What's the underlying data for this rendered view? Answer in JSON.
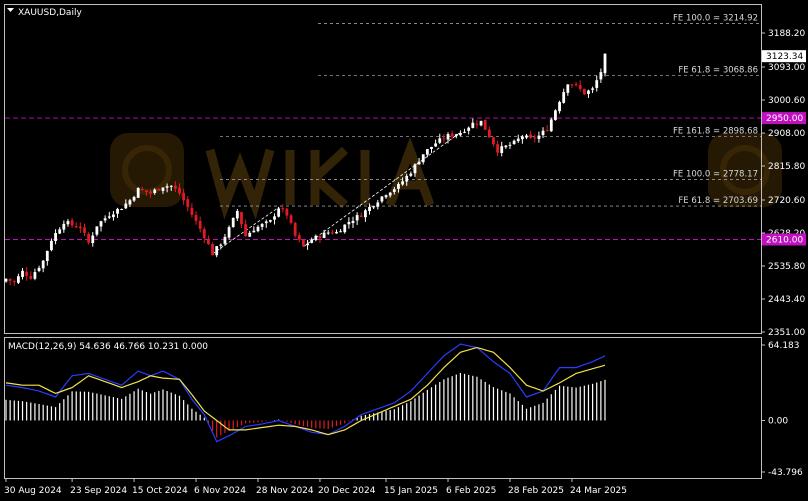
{
  "window": {
    "symbol_label": "XAUUSD,Daily"
  },
  "colors": {
    "background": "#000000",
    "bull": "#ffffff",
    "bear": "#e01b24",
    "grid": "#9a9a9a",
    "level": "#c010c0",
    "macd": "#2a3cff",
    "signal": "#f2e24a",
    "watermark": "#3a2808"
  },
  "chart_data": [
    {
      "type": "candlestick",
      "title": "XAUUSD,Daily",
      "ylim": [
        2351.0,
        3250.0
      ],
      "y_ticks": [
        "3188.20",
        "3093.00",
        "3000.60",
        "2908.00",
        "2815.80",
        "2720.60",
        "2628.20",
        "2535.80",
        "2443.40",
        "2351.00"
      ],
      "x_ticks": [
        "30 Aug 2024",
        "23 Sep 2024",
        "15 Oct 2024",
        "6 Nov 2024",
        "28 Nov 2024",
        "20 Dec 2024",
        "15 Jan 2025",
        "6 Feb 2025",
        "28 Feb 2025",
        "24 Mar 2025"
      ],
      "current_price": "3123.34",
      "fib_levels": [
        {
          "label": "FE 100.0 = 3214.92",
          "value": 3214.92
        },
        {
          "label": "FE 61.8 = 3068.86",
          "value": 3068.86
        },
        {
          "label": "FE 161.8 = 2898.68",
          "value": 2898.68
        },
        {
          "label": "FE 100.0 = 2778.17",
          "value": 2778.17
        },
        {
          "label": "FE 61.8 = 2703.69",
          "value": 2703.69
        }
      ],
      "horizontal_levels": [
        {
          "label": "2950.00",
          "value": 2950.0
        },
        {
          "label": "2610.00",
          "value": 2610.0
        }
      ],
      "close_anchors": [
        [
          0,
          2500
        ],
        [
          2,
          2490
        ],
        [
          4,
          2520
        ],
        [
          6,
          2505
        ],
        [
          9,
          2550
        ],
        [
          11,
          2610
        ],
        [
          14,
          2660
        ],
        [
          16,
          2650
        ],
        [
          18,
          2645
        ],
        [
          20,
          2600
        ],
        [
          22,
          2650
        ],
        [
          25,
          2680
        ],
        [
          28,
          2700
        ],
        [
          30,
          2720
        ],
        [
          32,
          2750
        ],
        [
          35,
          2740
        ],
        [
          38,
          2760
        ],
        [
          40,
          2760
        ],
        [
          42,
          2740
        ],
        [
          44,
          2700
        ],
        [
          46,
          2660
        ],
        [
          48,
          2620
        ],
        [
          50,
          2570
        ],
        [
          52,
          2600
        ],
        [
          54,
          2640
        ],
        [
          56,
          2690
        ],
        [
          58,
          2620
        ],
        [
          60,
          2640
        ],
        [
          62,
          2650
        ],
        [
          64,
          2660
        ],
        [
          66,
          2700
        ],
        [
          68,
          2680
        ],
        [
          70,
          2620
        ],
        [
          72,
          2590
        ],
        [
          74,
          2610
        ],
        [
          76,
          2620
        ],
        [
          78,
          2630
        ],
        [
          80,
          2630
        ],
        [
          83,
          2660
        ],
        [
          86,
          2680
        ],
        [
          89,
          2710
        ],
        [
          92,
          2740
        ],
        [
          95,
          2760
        ],
        [
          98,
          2800
        ],
        [
          101,
          2850
        ],
        [
          104,
          2880
        ],
        [
          107,
          2900
        ],
        [
          110,
          2910
        ],
        [
          113,
          2935
        ],
        [
          115,
          2940
        ],
        [
          117,
          2900
        ],
        [
          119,
          2860
        ],
        [
          121,
          2870
        ],
        [
          123,
          2880
        ],
        [
          125,
          2900
        ],
        [
          127,
          2890
        ],
        [
          129,
          2900
        ],
        [
          131,
          2920
        ],
        [
          134,
          3000
        ],
        [
          136,
          3050
        ],
        [
          138,
          3040
        ],
        [
          140,
          3020
        ],
        [
          142,
          3030
        ],
        [
          144,
          3080
        ],
        [
          145,
          3123.34
        ]
      ],
      "macd": {
        "label": "MACD(12,26,9) 54.636 46.766 10.231 0.000",
        "ylim": [
          -43.796,
          64.183
        ],
        "y_ticks": [
          "64.183",
          "0.00",
          "-43.796"
        ],
        "macd_anchors": [
          [
            0,
            30
          ],
          [
            4,
            28
          ],
          [
            8,
            25
          ],
          [
            12,
            20
          ],
          [
            16,
            38
          ],
          [
            20,
            40
          ],
          [
            24,
            35
          ],
          [
            28,
            30
          ],
          [
            32,
            42
          ],
          [
            35,
            38
          ],
          [
            38,
            42
          ],
          [
            42,
            35
          ],
          [
            45,
            18
          ],
          [
            48,
            5
          ],
          [
            51,
            -18
          ],
          [
            54,
            -13
          ],
          [
            58,
            -5
          ],
          [
            62,
            -3
          ],
          [
            66,
            0
          ],
          [
            70,
            -5
          ],
          [
            74,
            -10
          ],
          [
            78,
            -12
          ],
          [
            82,
            -5
          ],
          [
            86,
            5
          ],
          [
            90,
            10
          ],
          [
            94,
            15
          ],
          [
            98,
            25
          ],
          [
            102,
            40
          ],
          [
            106,
            55
          ],
          [
            110,
            65
          ],
          [
            114,
            62
          ],
          [
            118,
            50
          ],
          [
            122,
            40
          ],
          [
            126,
            20
          ],
          [
            130,
            25
          ],
          [
            134,
            45
          ],
          [
            138,
            45
          ],
          [
            142,
            50
          ],
          [
            145,
            55
          ]
        ],
        "signal_anchors": [
          [
            0,
            32
          ],
          [
            4,
            30
          ],
          [
            8,
            30
          ],
          [
            12,
            23
          ],
          [
            16,
            28
          ],
          [
            20,
            38
          ],
          [
            24,
            33
          ],
          [
            28,
            28
          ],
          [
            32,
            33
          ],
          [
            35,
            38
          ],
          [
            38,
            36
          ],
          [
            42,
            35
          ],
          [
            45,
            22
          ],
          [
            48,
            8
          ],
          [
            51,
            0
          ],
          [
            54,
            -8
          ],
          [
            58,
            -8
          ],
          [
            62,
            -6
          ],
          [
            66,
            -4
          ],
          [
            70,
            -5
          ],
          [
            74,
            -8
          ],
          [
            78,
            -12
          ],
          [
            82,
            -8
          ],
          [
            86,
            0
          ],
          [
            90,
            6
          ],
          [
            94,
            12
          ],
          [
            98,
            18
          ],
          [
            102,
            30
          ],
          [
            106,
            45
          ],
          [
            110,
            58
          ],
          [
            114,
            62
          ],
          [
            118,
            58
          ],
          [
            122,
            45
          ],
          [
            126,
            30
          ],
          [
            130,
            25
          ],
          [
            134,
            32
          ],
          [
            138,
            40
          ],
          [
            142,
            44
          ],
          [
            145,
            47
          ]
        ]
      }
    }
  ]
}
